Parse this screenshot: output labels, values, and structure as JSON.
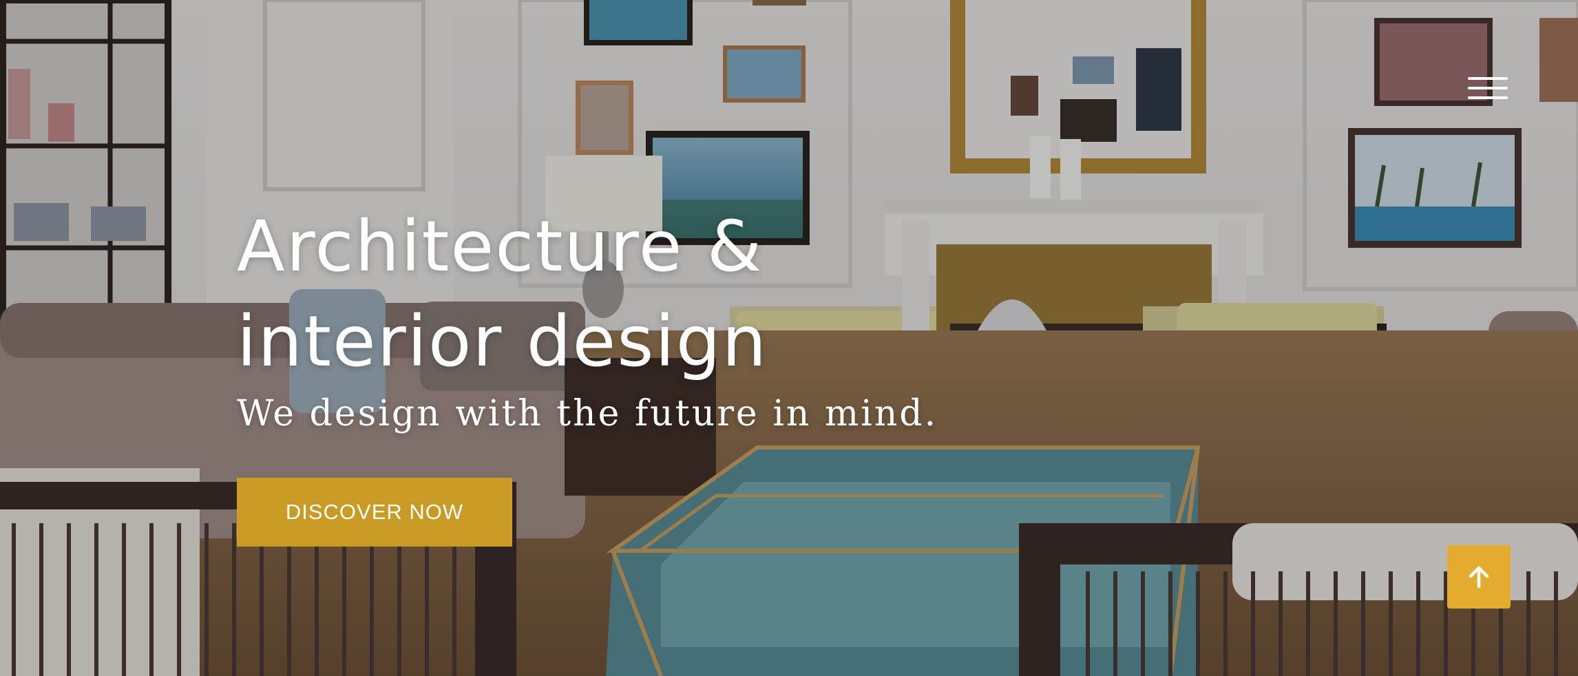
{
  "hero": {
    "title": "Architecture & interior design",
    "subtitle": "We design with the future in mind.",
    "cta_label": "DISCOVER NOW"
  },
  "icons": {
    "menu": "hamburger-menu-icon",
    "scroll_top": "arrow-up-icon"
  },
  "colors": {
    "accent": "#c99a24",
    "scroll_top": "#e3ac2f",
    "text": "#ffffff"
  }
}
